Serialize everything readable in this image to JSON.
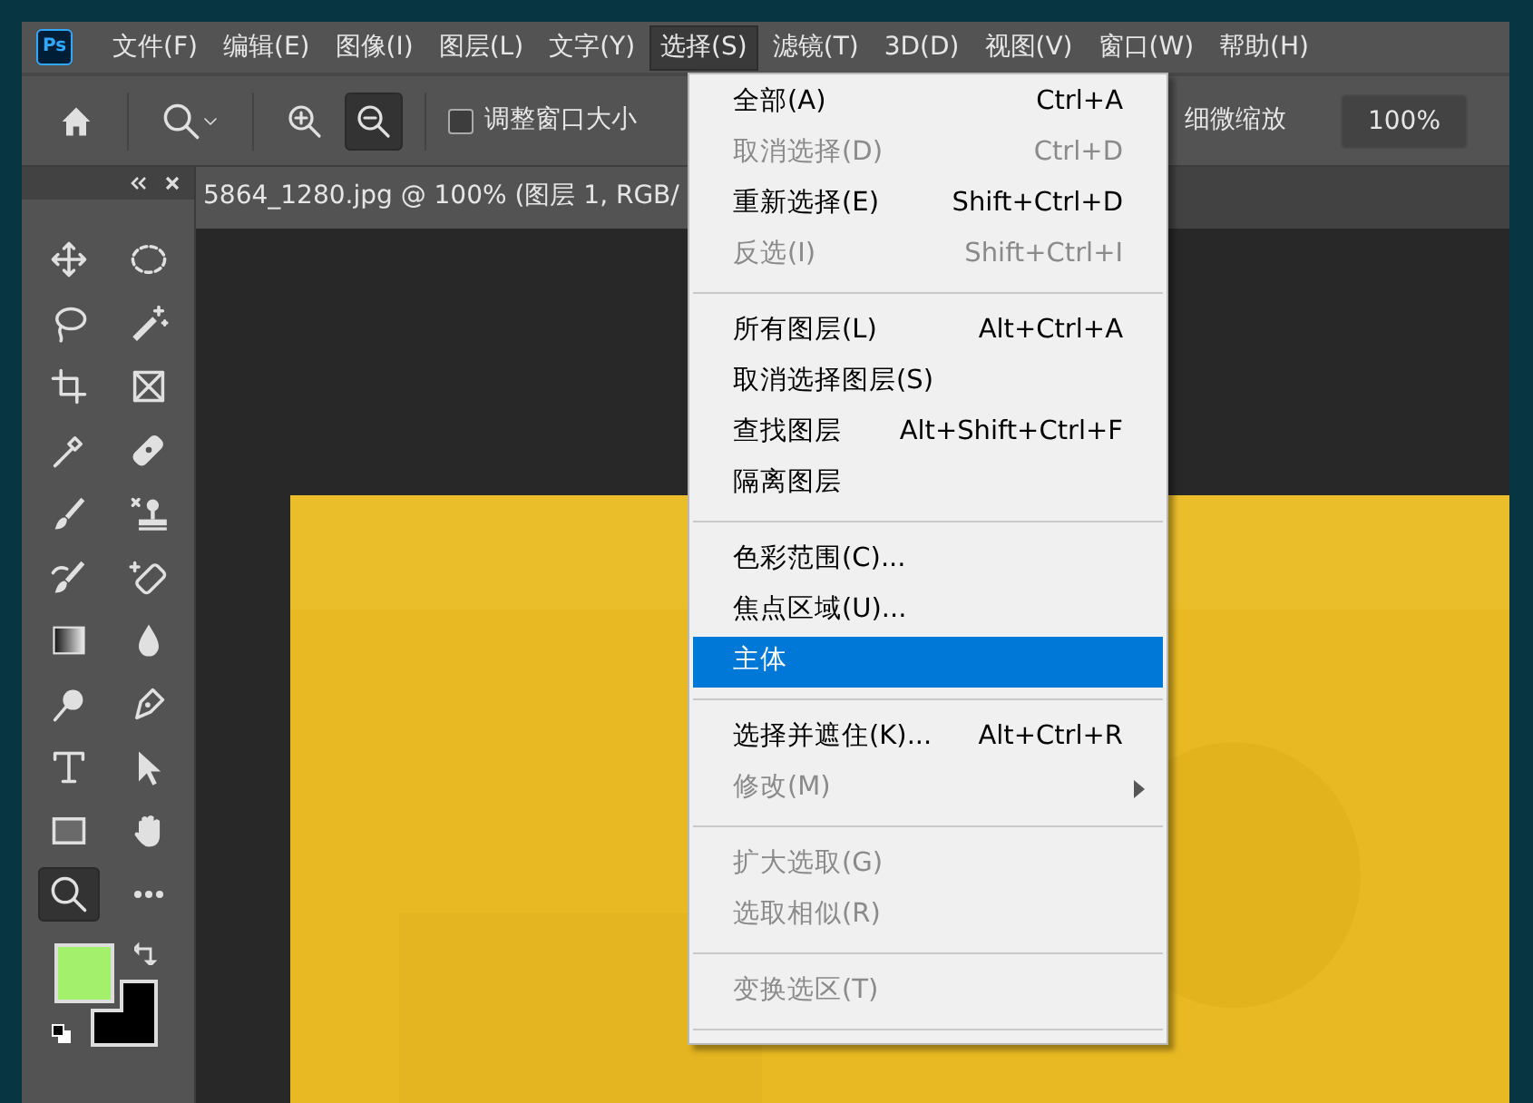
{
  "app_logo": "Ps",
  "menu_bar": [
    {
      "label": "文件(F)",
      "selected": false
    },
    {
      "label": "编辑(E)",
      "selected": false
    },
    {
      "label": "图像(I)",
      "selected": false
    },
    {
      "label": "图层(L)",
      "selected": false
    },
    {
      "label": "文字(Y)",
      "selected": false
    },
    {
      "label": "选择(S)",
      "selected": true
    },
    {
      "label": "滤镜(T)",
      "selected": false
    },
    {
      "label": "3D(D)",
      "selected": false
    },
    {
      "label": "视图(V)",
      "selected": false
    },
    {
      "label": "窗口(W)",
      "selected": false
    },
    {
      "label": "帮助(H)",
      "selected": false
    }
  ],
  "options_bar": {
    "zoom_out_selected": true,
    "resize_windows": {
      "label": "调整窗口大小",
      "checked": false
    },
    "scrubby_zoom_label": "细微缩放",
    "zoom_value": "100%"
  },
  "document_tab": {
    "title": "5864_1280.jpg @ 100% (图层 1, RGB/"
  },
  "tools": [
    {
      "selected": false
    },
    {
      "selected": false
    },
    {
      "selected": false
    },
    {
      "selected": false
    },
    {
      "selected": false
    },
    {
      "selected": false
    },
    {
      "selected": false
    },
    {
      "selected": false
    },
    {
      "selected": false
    },
    {
      "selected": false
    },
    {
      "selected": false
    },
    {
      "selected": false
    },
    {
      "selected": false
    },
    {
      "selected": false
    },
    {
      "selected": false
    },
    {
      "selected": false
    },
    {
      "selected": false
    },
    {
      "selected": false
    },
    {
      "selected": false
    },
    {
      "selected": false
    },
    {
      "selected": true
    },
    {
      "selected": false
    }
  ],
  "colors": {
    "foreground": {
      "color": "#a2f06c"
    },
    "background": {
      "color": "#000000"
    }
  },
  "select_menu": [
    {
      "kind": "item",
      "label": "全部(A)",
      "shortcut": "Ctrl+A",
      "disabled": false,
      "selected": false
    },
    {
      "kind": "item",
      "label": "取消选择(D)",
      "shortcut": "Ctrl+D",
      "disabled": true,
      "selected": false
    },
    {
      "kind": "item",
      "label": "重新选择(E)",
      "shortcut": "Shift+Ctrl+D",
      "disabled": false,
      "selected": false
    },
    {
      "kind": "item",
      "label": "反选(I)",
      "shortcut": "Shift+Ctrl+I",
      "disabled": true,
      "selected": false
    },
    {
      "kind": "separator"
    },
    {
      "kind": "item",
      "label": "所有图层(L)",
      "shortcut": "Alt+Ctrl+A",
      "disabled": false,
      "selected": false
    },
    {
      "kind": "item",
      "label": "取消选择图层(S)",
      "disabled": false,
      "selected": false
    },
    {
      "kind": "item",
      "label": "查找图层",
      "shortcut": "Alt+Shift+Ctrl+F",
      "disabled": false,
      "selected": false
    },
    {
      "kind": "item",
      "label": "隔离图层",
      "disabled": false,
      "selected": false
    },
    {
      "kind": "separator"
    },
    {
      "kind": "item",
      "label": "色彩范围(C)...",
      "disabled": false,
      "selected": false
    },
    {
      "kind": "item",
      "label": "焦点区域(U)...",
      "disabled": false,
      "selected": false
    },
    {
      "kind": "item",
      "label": "主体",
      "disabled": false,
      "selected": true
    },
    {
      "kind": "separator"
    },
    {
      "kind": "item",
      "label": "选择并遮住(K)...",
      "shortcut": "Alt+Ctrl+R",
      "disabled": false,
      "selected": false
    },
    {
      "kind": "item",
      "label": "修改(M)",
      "disabled": true,
      "selected": false,
      "submenu": true
    },
    {
      "kind": "separator"
    },
    {
      "kind": "item",
      "label": "扩大选取(G)",
      "disabled": true,
      "selected": false
    },
    {
      "kind": "item",
      "label": "选取相似(R)",
      "disabled": true,
      "selected": false
    },
    {
      "kind": "separator"
    },
    {
      "kind": "item",
      "label": "变换选区(T)",
      "disabled": true,
      "selected": false
    },
    {
      "kind": "separator"
    }
  ]
}
